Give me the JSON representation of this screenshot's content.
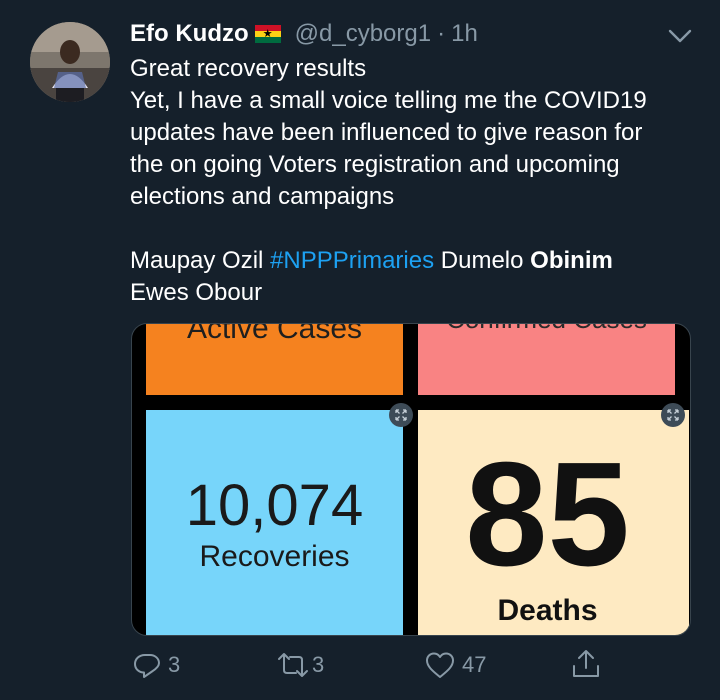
{
  "author": {
    "name": "Efo Kudzo",
    "flag_icon": "ghana-flag-icon",
    "handle": "@d_cyborg1",
    "separator": "·",
    "time": "1h"
  },
  "tweet": {
    "lines": [
      "Great recovery results",
      "Yet, I have a small voice telling me the COVID19",
      "updates have been influenced to give reason for",
      "the on going Voters registration and upcoming",
      "elections and campaigns"
    ],
    "tags_line": {
      "plain1": "Maupay Ozil ",
      "hashtag": "#NPPPrimaries",
      "plain2": " Dumelo ",
      "bold": "Obinim"
    },
    "tags_line2": "Ewes Obour"
  },
  "media": {
    "active_label": "Active Cases",
    "confirmed_label": "Confirmed Cases",
    "recoveries_value": "10,074",
    "recoveries_label": "Recoveries",
    "deaths_value": "85",
    "deaths_label": "Deaths",
    "colors": {
      "active": "#f5821f",
      "confirmed": "#f98383",
      "recoveries": "#77d5fa",
      "deaths": "#feeac2"
    }
  },
  "actions": {
    "replies": "3",
    "retweets": "3",
    "likes": "47"
  }
}
